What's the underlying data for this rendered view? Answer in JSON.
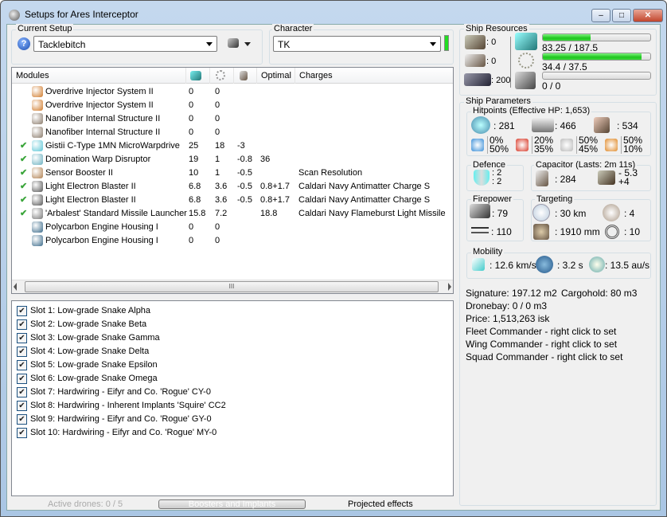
{
  "window": {
    "title": "Setups for Ares Interceptor",
    "minimize": "–",
    "maximize": "□",
    "close": "✕"
  },
  "setup": {
    "label": "Current Setup",
    "value": "Tacklebitch",
    "help_icon": "help-icon",
    "ship_menu_icon": "ship-icon"
  },
  "character": {
    "label": "Character",
    "value": "TK",
    "status_color": "#22dd22"
  },
  "modules": {
    "headers": [
      "Modules",
      "cpu-icon",
      "powergrid-icon",
      "capacitor-icon",
      "Optimal",
      "Charges"
    ],
    "rows": [
      {
        "active": false,
        "name": "Overdrive Injector System II",
        "cpu": "0",
        "pg": "0",
        "cap": "",
        "optimal": "",
        "charges": "",
        "color": "#d07a2a"
      },
      {
        "active": false,
        "name": "Overdrive Injector System II",
        "cpu": "0",
        "pg": "0",
        "cap": "",
        "optimal": "",
        "charges": "",
        "color": "#d07a2a"
      },
      {
        "active": false,
        "name": "Nanofiber Internal Structure II",
        "cpu": "0",
        "pg": "0",
        "cap": "",
        "optimal": "",
        "charges": "",
        "color": "#8a7a6a"
      },
      {
        "active": false,
        "name": "Nanofiber Internal Structure II",
        "cpu": "0",
        "pg": "0",
        "cap": "",
        "optimal": "",
        "charges": "",
        "color": "#8a7a6a"
      },
      {
        "active": true,
        "name": "Gistii C-Type 1MN MicroWarpdrive",
        "cpu": "25",
        "pg": "18",
        "cap": "-3",
        "optimal": "",
        "charges": "",
        "color": "#5cc6d6"
      },
      {
        "active": true,
        "name": "Domination Warp Disruptor",
        "cpu": "19",
        "pg": "1",
        "cap": "-0.8",
        "optimal": "36",
        "charges": "",
        "color": "#6ab0c0"
      },
      {
        "active": true,
        "name": "Sensor Booster II",
        "cpu": "10",
        "pg": "1",
        "cap": "-0.5",
        "optimal": "",
        "charges": "Scan Resolution",
        "color": "#b08050"
      },
      {
        "active": true,
        "name": "Light Electron Blaster II",
        "cpu": "6.8",
        "pg": "3.6",
        "cap": "-0.5",
        "optimal": "0.8+1.7",
        "charges": "Caldari Navy Antimatter Charge S",
        "color": "#555"
      },
      {
        "active": true,
        "name": "Light Electron Blaster II",
        "cpu": "6.8",
        "pg": "3.6",
        "cap": "-0.5",
        "optimal": "0.8+1.7",
        "charges": "Caldari Navy Antimatter Charge S",
        "color": "#555"
      },
      {
        "active": true,
        "name": "'Arbalest' Standard Missile Launcher",
        "cpu": "15.8",
        "pg": "7.2",
        "cap": "",
        "optimal": "18.8",
        "charges": "Caldari Navy Flameburst Light Missile",
        "color": "#777"
      },
      {
        "active": false,
        "name": "Polycarbon Engine Housing I",
        "cpu": "0",
        "pg": "0",
        "cap": "",
        "optimal": "",
        "charges": "",
        "color": "#3a6a8a"
      },
      {
        "active": false,
        "name": "Polycarbon Engine Housing I",
        "cpu": "0",
        "pg": "0",
        "cap": "",
        "optimal": "",
        "charges": "",
        "color": "#3a6a8a"
      }
    ],
    "scroll_grip": "III"
  },
  "implants": [
    "Slot 1: Low-grade Snake Alpha",
    "Slot 2: Low-grade Snake Beta",
    "Slot 3: Low-grade Snake Gamma",
    "Slot 4: Low-grade Snake Delta",
    "Slot 5: Low-grade Snake Epsilon",
    "Slot 6: Low-grade Snake Omega",
    "Slot 7: Hardwiring - Eifyr and Co. 'Rogue' CY-0",
    "Slot 8: Hardwiring - Inherent Implants 'Squire' CC2",
    "Slot 9: Hardwiring - Eifyr and Co. 'Rogue' GY-0",
    "Slot 10: Hardwiring - Eifyr and Co. 'Rogue' MY-0"
  ],
  "bottom": {
    "active_drones": "Active drones: 0 / 5",
    "boosters_tab": "Boosters and Implants",
    "projected_tab": "Projected effects"
  },
  "resources": {
    "label": "Ship Resources",
    "turrets": ": 0",
    "launchers": ": 0",
    "calibration": ": 200",
    "cpu": {
      "text": "83.25 / 187.5",
      "fraction": 0.444
    },
    "powergrid": {
      "text": "34.4 / 37.5",
      "fraction": 0.917
    },
    "drone_bandwidth": {
      "text": "0 / 0",
      "fraction": 0
    }
  },
  "params": {
    "label": "Ship Parameters",
    "hitpoints": {
      "label": "Hitpoints (Effective HP: 1,653)",
      "shield": ": 281",
      "armor": ": 466",
      "structure": ": 534",
      "resists": [
        {
          "icon": "em-icon",
          "a": "0%",
          "b": "50%"
        },
        {
          "icon": "thermal-icon",
          "a": "20%",
          "b": "35%"
        },
        {
          "icon": "kinetic-icon",
          "a": "50%",
          "b": "45%"
        },
        {
          "icon": "explosive-icon",
          "a": "50%",
          "b": "10%"
        }
      ]
    },
    "defence": {
      "label": "Defence",
      "a": ": 2",
      "b": ": 2"
    },
    "capacitor": {
      "label": "Capacitor (Lasts: 2m 11s)",
      "capacity": ": 284",
      "a": "- 5.3",
      "b": "+4"
    },
    "firepower": {
      "label": "Firepower",
      "turret": ": 79",
      "missile": ": 110"
    },
    "targeting": {
      "label": "Targeting",
      "range": ": 30 km",
      "targets": ": 4",
      "resolution": ": 1910 mm",
      "sensor": ": 10"
    },
    "mobility": {
      "label": "Mobility",
      "speed": ": 12.6 km/s",
      "align": ": 3.2 s",
      "warp": ": 13.5 au/s"
    },
    "signature": "Signature: 197.12 m2",
    "cargo": "Cargohold: 80 m3",
    "dronebay": "Dronebay: 0 / 0 m3",
    "price": "Price: 1,513,263 isk",
    "fleet": "Fleet Commander - right click to set",
    "wing": "Wing Commander - right click to set",
    "squad": "Squad Commander - right click to set"
  }
}
